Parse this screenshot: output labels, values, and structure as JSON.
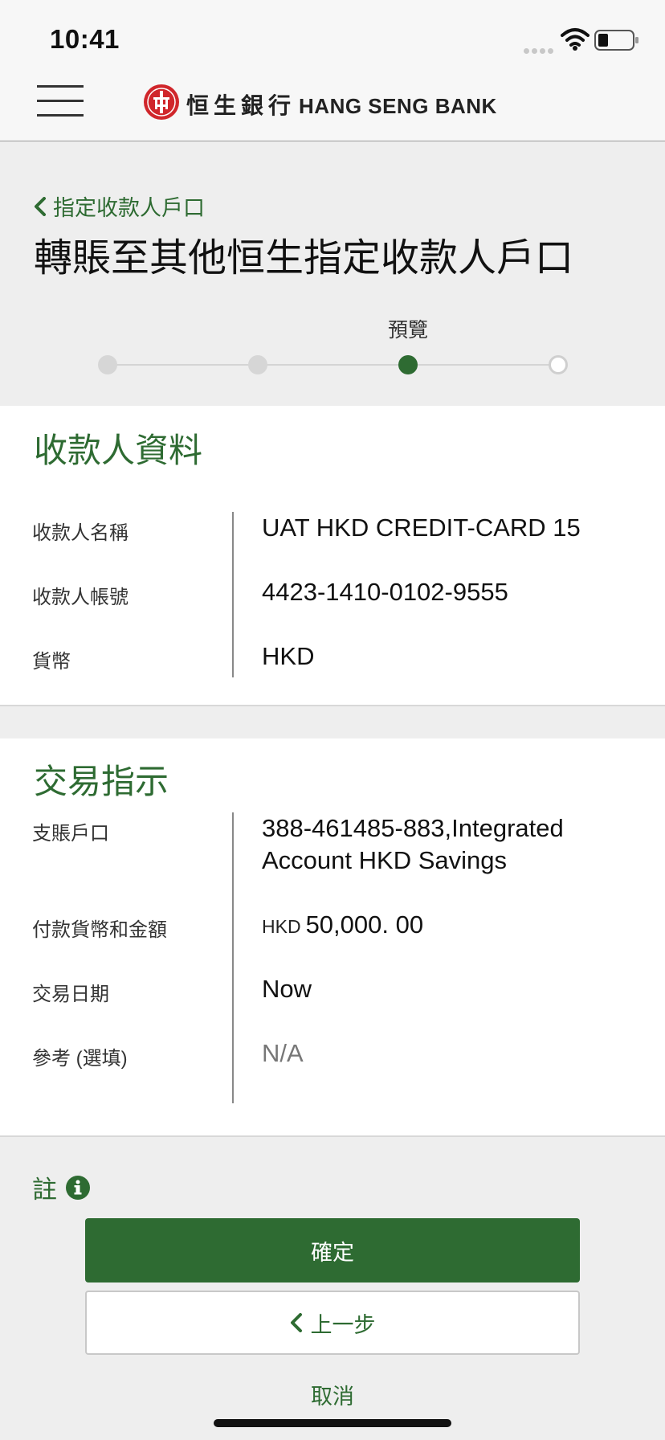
{
  "status_bar": {
    "time": "10:41"
  },
  "header": {
    "bank_name_zh": "恒生銀行",
    "bank_name_en": "HANG SENG BANK",
    "menu_icon": "hamburger-menu-icon",
    "logo_icon": "hang-seng-logo-icon"
  },
  "title_area": {
    "back_label": "指定收款人戶口",
    "page_title": "轉賬至其他恒生指定收款人戶口",
    "stepper": {
      "current_label": "預覽",
      "total_steps": 4,
      "current_step": 3
    }
  },
  "payee": {
    "title": "收款人資料",
    "rows": [
      {
        "label": "收款人名稱",
        "value": "UAT HKD CREDIT-CARD 15"
      },
      {
        "label": "收款人帳號",
        "value": "4423-1410-0102-9555"
      },
      {
        "label": "貨幣",
        "value": "HKD"
      }
    ]
  },
  "instruction": {
    "title": "交易指示",
    "debit_account": {
      "label": "支賬戶口",
      "line1": "388-461485-883,Integrated",
      "line2": "Account HKD Savings"
    },
    "amount": {
      "label": "付款貨幣和金額",
      "currency": "HKD",
      "value": "50,000. 00"
    },
    "date": {
      "label": "交易日期",
      "value": "Now"
    },
    "reference": {
      "label": "參考 (選填)",
      "value": "N/A"
    }
  },
  "footer": {
    "note_label": "註",
    "confirm_label": "確定",
    "back_label": "上一步",
    "cancel_label": "取消"
  },
  "colors": {
    "brand_green": "#2e6b32",
    "logo_red": "#d0262b",
    "background": "#eeeeee"
  }
}
